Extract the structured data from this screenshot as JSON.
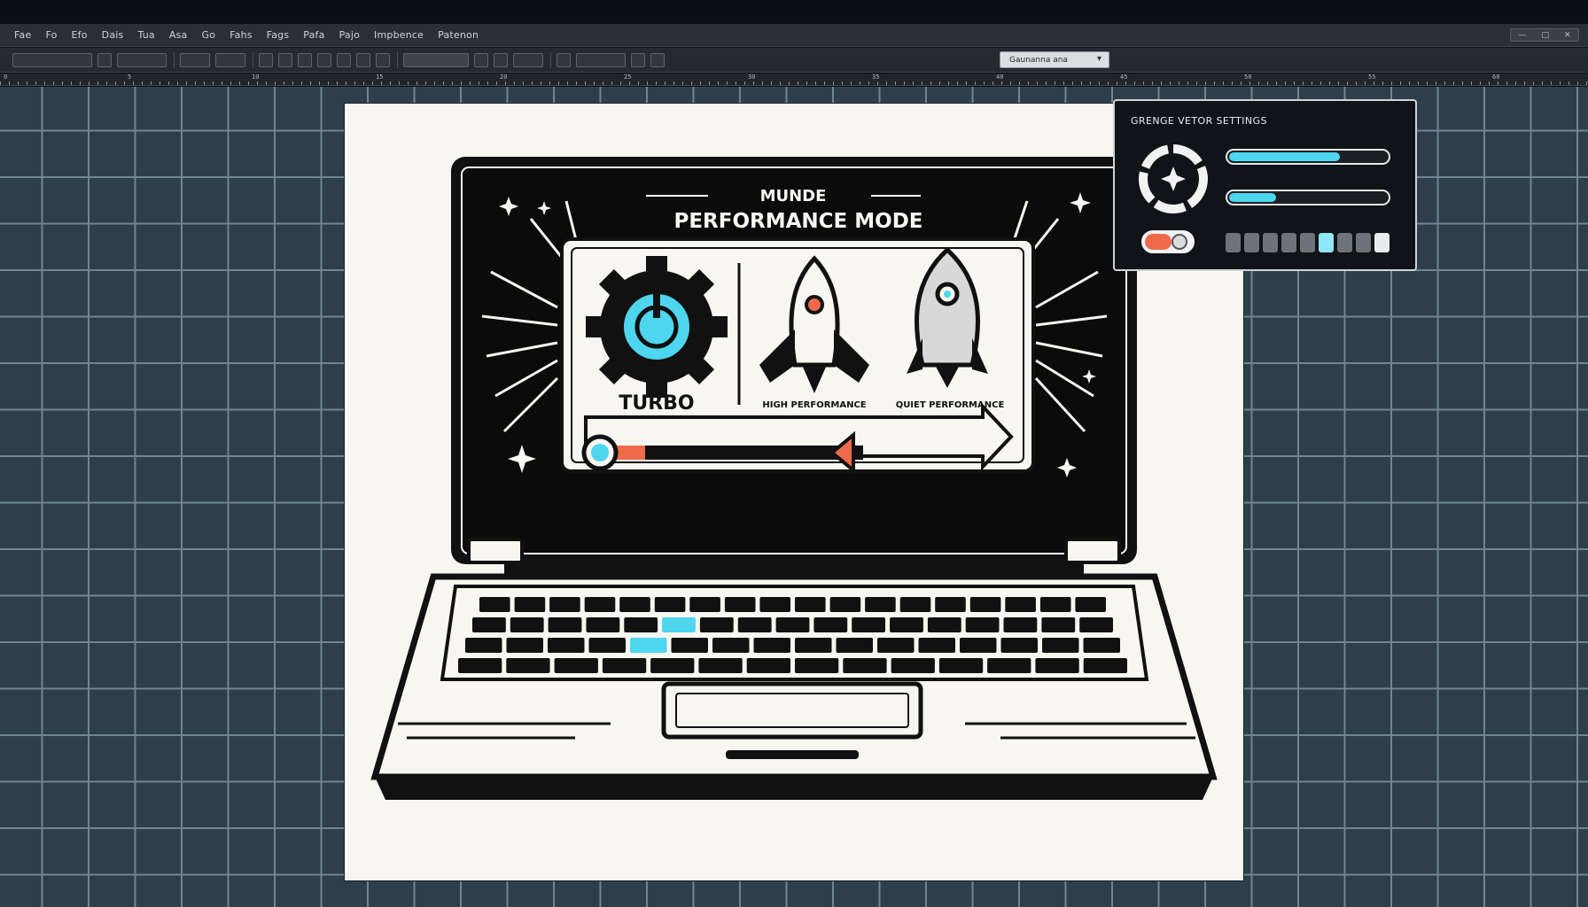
{
  "menu": {
    "items": [
      "Fae",
      "Fo",
      "Efo",
      "Dais",
      "Tua",
      "Asa",
      "Go",
      "Fahs",
      "Fags",
      "Pafa",
      "Pajo",
      "Impbence",
      "Patenon"
    ]
  },
  "toolbar": {
    "preset_select": "Gaunanna ana"
  },
  "window": {
    "controls": [
      "—",
      "□",
      "✕"
    ]
  },
  "ruler": {
    "labels": [
      "0",
      "5",
      "10",
      "15",
      "20",
      "25",
      "30",
      "35",
      "40",
      "45",
      "50",
      "55",
      "60"
    ]
  },
  "artwork": {
    "heading_small": "MUNDE",
    "heading": "PERFORMANCE MODE",
    "modes": [
      {
        "label": "TURBO",
        "icon": "gear-power-icon"
      },
      {
        "label": "HIGH PERFORMANCE",
        "icon": "rocket-icon"
      },
      {
        "label": "QUIET PERFORMANCE",
        "icon": "rocket-icon"
      }
    ],
    "slider_value": 0.6
  },
  "settings_panel": {
    "title": "GRENGE VETOR SETTINGS",
    "slider_1_fill": 0.7,
    "slider_2_fill": 0.3,
    "toggle_on": true,
    "levels": [
      "off",
      "off",
      "off",
      "off",
      "off",
      "on",
      "off",
      "off",
      "lit"
    ]
  },
  "colors": {
    "accent": "#4dd6ee",
    "warning": "#ef6a4a",
    "canvas": "#2e3f4b",
    "artboard": "#f7f6f0"
  }
}
